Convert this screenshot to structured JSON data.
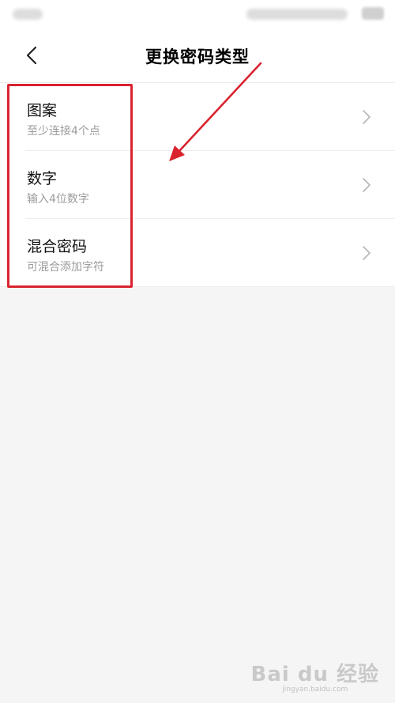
{
  "header": {
    "title": "更换密码类型",
    "back_icon": "chevron-left-icon"
  },
  "options": [
    {
      "title": "图案",
      "subtitle": "至少连接4个点"
    },
    {
      "title": "数字",
      "subtitle": "输入4位数字"
    },
    {
      "title": "混合密码",
      "subtitle": "可混合添加字符"
    }
  ],
  "annotation": {
    "color": "#d9242f"
  },
  "watermark": {
    "logo": "Bai du 经验",
    "url": "jingyan.baidu.com"
  }
}
